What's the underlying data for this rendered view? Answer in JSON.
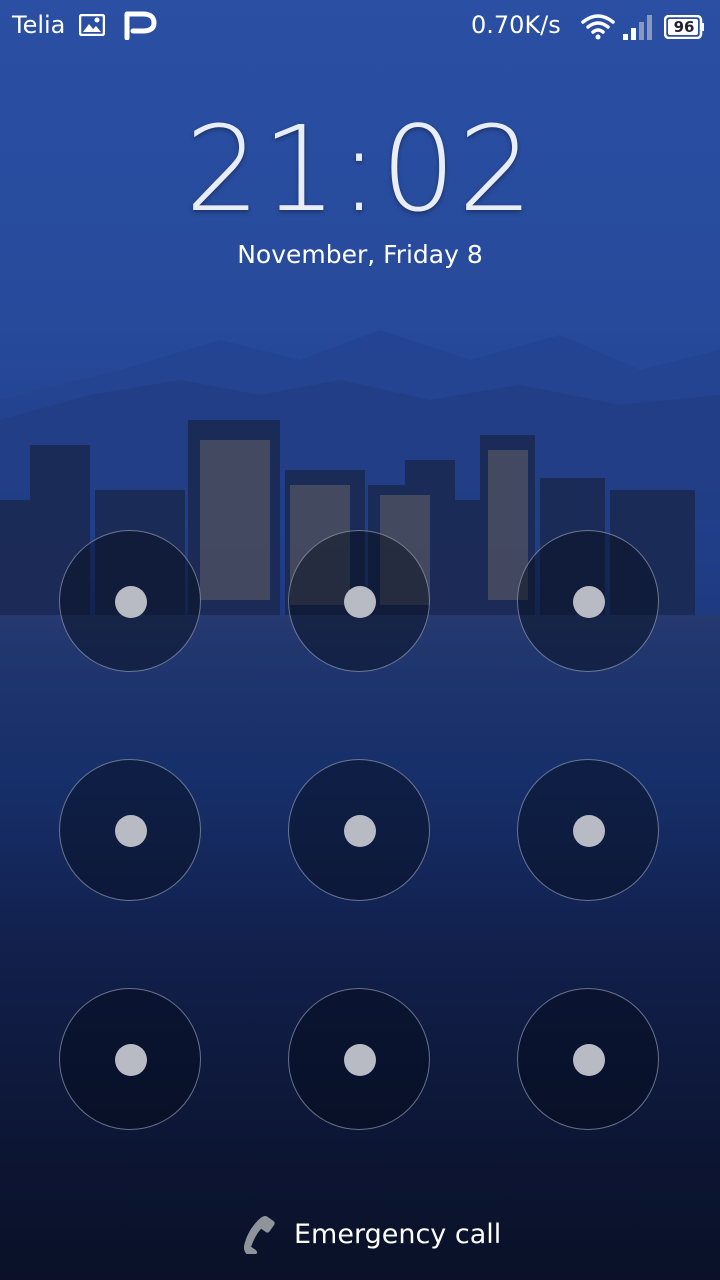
{
  "status_bar": {
    "carrier": "Telia",
    "network_speed": "0.70K/s",
    "battery_level": "96",
    "icons": [
      "gallery-icon",
      "p-app-icon",
      "wifi-icon",
      "signal-icon",
      "battery-icon"
    ]
  },
  "lock_screen": {
    "time": "21:02",
    "date": "November, Friday 8"
  },
  "pattern_grid": {
    "rows": 3,
    "cols": 3
  },
  "emergency": {
    "label": "Emergency call"
  },
  "colors": {
    "background_top": "#2a4fa3",
    "background_bottom": "#0a1128",
    "dot": "#b8bac4"
  }
}
